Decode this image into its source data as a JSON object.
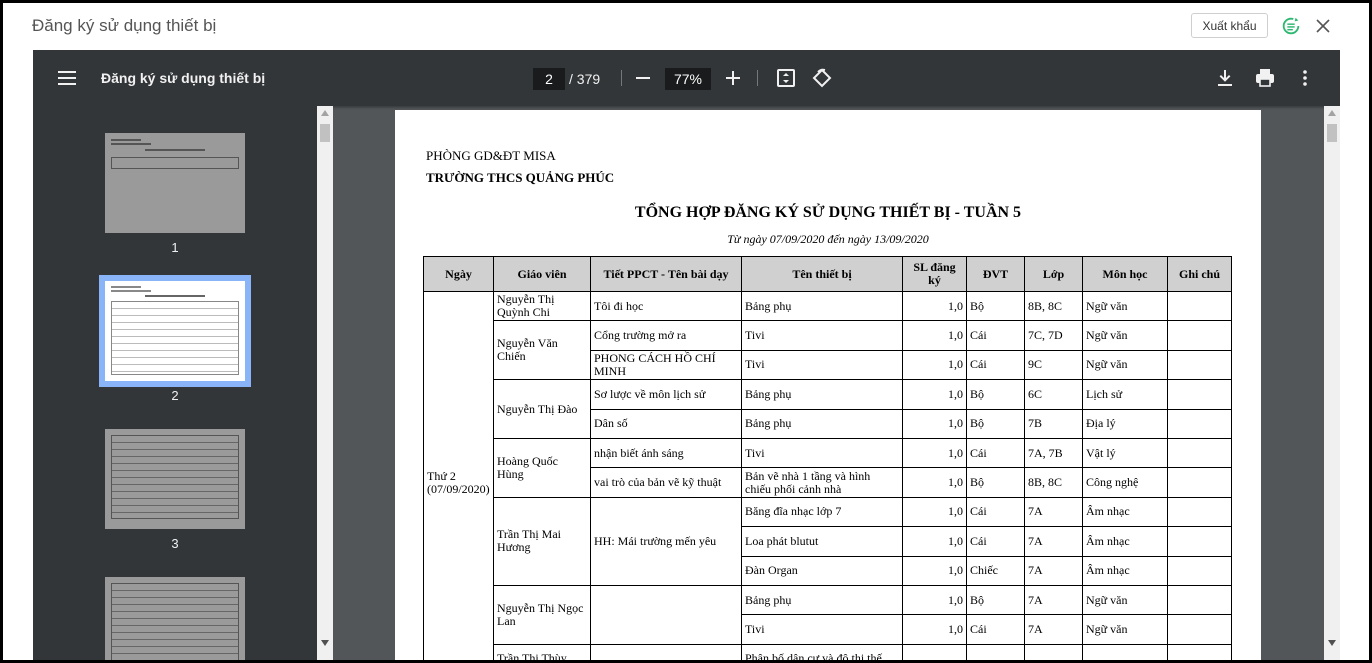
{
  "dialog": {
    "title": "Đăng ký sử dụng thiết bị",
    "export_label": "Xuất khẩu"
  },
  "toolbar": {
    "doc_title": "Đăng ký sử dụng thiết bị",
    "page_current": "2",
    "page_total": "/ 379",
    "zoom": "77%"
  },
  "thumbnails": [
    {
      "label": "1"
    },
    {
      "label": "2"
    },
    {
      "label": "3"
    }
  ],
  "colors": {
    "viewer_bg": "#525659",
    "toolbar_bg": "#323639",
    "thumb_selected": "#8ab4f8",
    "header_fill": "#d0d0d0"
  },
  "report": {
    "org_line1": "PHÒNG GD&ĐT MISA",
    "org_line2": "TRƯỜNG THCS QUẢNG PHÚC",
    "title": "TỔNG HỢP ĐĂNG KÝ SỬ DỤNG THIẾT BỊ - TUẦN 5",
    "subtitle": "Từ ngày 07/09/2020 đến ngày 13/09/2020",
    "headers": [
      "Ngày",
      "Giáo viên",
      "Tiết PPCT - Tên bài dạy",
      "Tên thiết bị",
      "SL đăng ký",
      "ĐVT",
      "Lớp",
      "Môn học",
      "Ghi chú"
    ],
    "day": "Thứ 2\n(07/09/2020)",
    "teachers": [
      "Nguyễn Thị Quỳnh Chi",
      "Nguyễn Văn Chiến",
      "Nguyễn Thị Đào",
      "Hoàng Quốc Hùng",
      "Trần Thị Mai Hương",
      "Nguyễn Thị Ngọc Lan",
      "Trần Thị Thùy"
    ],
    "lessons": [
      "Tôi đi học",
      "Cổng trường mở ra",
      "PHONG CÁCH HỒ CHÍ MINH",
      "Sơ lược về môn lịch sử",
      "Dân số",
      "nhận biết ánh sáng",
      "vai trò của bản vẽ kỹ thuật",
      "HH: Mái trường mến yêu"
    ],
    "rows": [
      {
        "device": "Bảng phụ",
        "qty": "1,0",
        "unit": "Bộ",
        "cls": "8B, 8C",
        "subject": "Ngữ văn",
        "note": ""
      },
      {
        "device": "Tivi",
        "qty": "1,0",
        "unit": "Cái",
        "cls": "7C, 7D",
        "subject": "Ngữ văn",
        "note": ""
      },
      {
        "device": "Tivi",
        "qty": "1,0",
        "unit": "Cái",
        "cls": "9C",
        "subject": "Ngữ văn",
        "note": ""
      },
      {
        "device": "Bảng phụ",
        "qty": "1,0",
        "unit": "Bộ",
        "cls": "6C",
        "subject": "Lịch sử",
        "note": ""
      },
      {
        "device": "Bảng phụ",
        "qty": "1,0",
        "unit": "Bộ",
        "cls": "7B",
        "subject": "Địa lý",
        "note": ""
      },
      {
        "device": "Tivi",
        "qty": "1,0",
        "unit": "Cái",
        "cls": "7A, 7B",
        "subject": "Vật lý",
        "note": ""
      },
      {
        "device": "Bản vẽ nhà 1 tầng và hình chiếu phối cảnh nhà",
        "qty": "1,0",
        "unit": "Bộ",
        "cls": "8B, 8C",
        "subject": "Công nghệ",
        "note": ""
      },
      {
        "device": "Băng đĩa nhạc lớp 7",
        "qty": "1,0",
        "unit": "Cái",
        "cls": "7A",
        "subject": "Âm nhạc",
        "note": ""
      },
      {
        "device": "Loa phát blutut",
        "qty": "1,0",
        "unit": "Cái",
        "cls": "7A",
        "subject": "Âm nhạc",
        "note": ""
      },
      {
        "device": "Đàn Organ",
        "qty": "1,0",
        "unit": "Chiếc",
        "cls": "7A",
        "subject": "Âm nhạc",
        "note": ""
      },
      {
        "device": "Bảng phụ",
        "qty": "1,0",
        "unit": "Bộ",
        "cls": "7A",
        "subject": "Ngữ văn",
        "note": ""
      },
      {
        "device": "Tivi",
        "qty": "1,0",
        "unit": "Cái",
        "cls": "7A",
        "subject": "Ngữ văn",
        "note": ""
      },
      {
        "device": "Phân bố dân cư và đô thị thế",
        "qty": "",
        "unit": "",
        "cls": "",
        "subject": "",
        "note": ""
      }
    ]
  }
}
